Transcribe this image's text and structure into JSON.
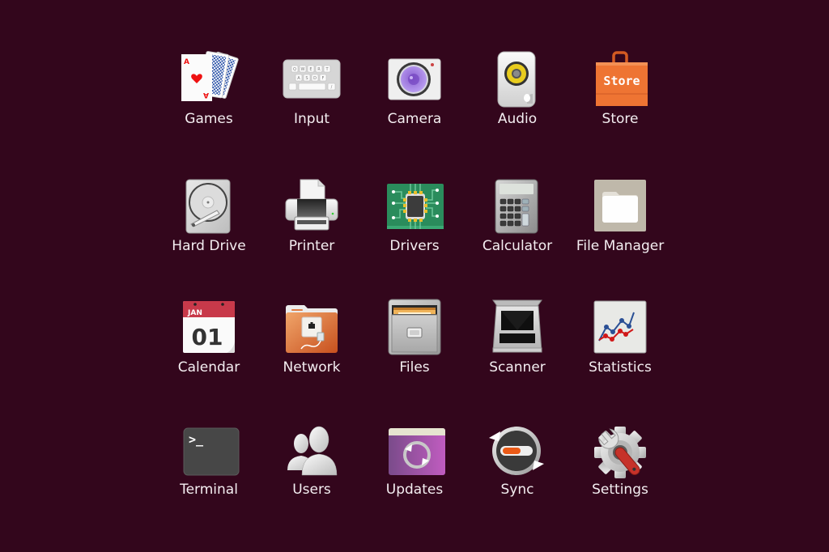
{
  "theme": {
    "background": "#33061c",
    "label_color": "#f4eef1"
  },
  "apps": [
    {
      "id": "games",
      "label": "Games",
      "icon": "playing-cards-icon"
    },
    {
      "id": "input",
      "label": "Input",
      "icon": "keyboard-icon",
      "keys_row1": [
        "Q",
        "W",
        "E",
        "R",
        "T"
      ],
      "keys_row2": [
        "A",
        "S",
        "D",
        "F"
      ],
      "key_slash": "/"
    },
    {
      "id": "camera",
      "label": "Camera",
      "icon": "camera-icon"
    },
    {
      "id": "audio",
      "label": "Audio",
      "icon": "speaker-icon"
    },
    {
      "id": "store",
      "label": "Store",
      "icon": "shopping-bag-icon",
      "badge_text": "Store"
    },
    {
      "id": "hard-drive",
      "label": "Hard Drive",
      "icon": "hard-drive-icon"
    },
    {
      "id": "printer",
      "label": "Printer",
      "icon": "printer-icon"
    },
    {
      "id": "drivers",
      "label": "Drivers",
      "icon": "chip-icon"
    },
    {
      "id": "calculator",
      "label": "Calculator",
      "icon": "calculator-icon"
    },
    {
      "id": "file-manager",
      "label": "File Manager",
      "icon": "folder-icon"
    },
    {
      "id": "calendar",
      "label": "Calendar",
      "icon": "calendar-icon",
      "month": "JAN",
      "day": "01"
    },
    {
      "id": "network",
      "label": "Network",
      "icon": "network-folder-icon"
    },
    {
      "id": "files",
      "label": "Files",
      "icon": "file-cabinet-icon"
    },
    {
      "id": "scanner",
      "label": "Scanner",
      "icon": "scanner-icon"
    },
    {
      "id": "statistics",
      "label": "Statistics",
      "icon": "line-chart-icon"
    },
    {
      "id": "terminal",
      "label": "Terminal",
      "icon": "terminal-icon",
      "prompt": ">_"
    },
    {
      "id": "users",
      "label": "Users",
      "icon": "users-icon"
    },
    {
      "id": "updates",
      "label": "Updates",
      "icon": "update-icon"
    },
    {
      "id": "sync",
      "label": "Sync",
      "icon": "sync-icon"
    },
    {
      "id": "settings",
      "label": "Settings",
      "icon": "gear-wrench-icon"
    }
  ]
}
